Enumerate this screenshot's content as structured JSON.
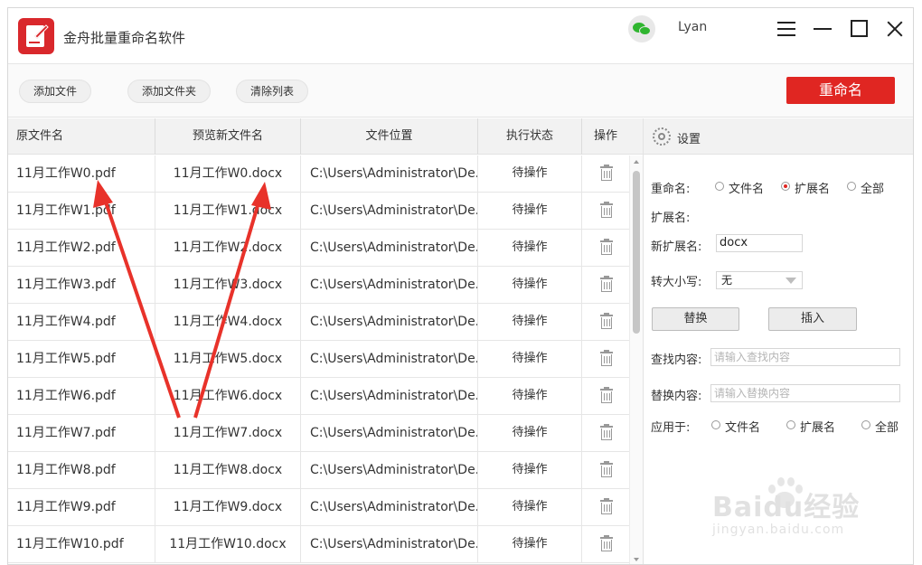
{
  "app": {
    "title": "金舟批量重命名软件",
    "user": "Lyan",
    "accent": "#e02622"
  },
  "toolbar": {
    "add_file": "添加文件",
    "add_folder": "添加文件夹",
    "clear_list": "清除列表",
    "rename": "重命名"
  },
  "table": {
    "headers": [
      "原文件名",
      "预览新文件名",
      "文件位置",
      "执行状态",
      "操作"
    ],
    "rows": [
      {
        "orig": "11月工作W0.pdf",
        "preview": "11月工作W0.docx",
        "path": "C:\\Users\\Administrator\\De...",
        "status": "待操作"
      },
      {
        "orig": "11月工作W1.pdf",
        "preview": "11月工作W1.docx",
        "path": "C:\\Users\\Administrator\\De...",
        "status": "待操作"
      },
      {
        "orig": "11月工作W2.pdf",
        "preview": "11月工作W2.docx",
        "path": "C:\\Users\\Administrator\\De...",
        "status": "待操作"
      },
      {
        "orig": "11月工作W3.pdf",
        "preview": "11月工作W3.docx",
        "path": "C:\\Users\\Administrator\\De...",
        "status": "待操作"
      },
      {
        "orig": "11月工作W4.pdf",
        "preview": "11月工作W4.docx",
        "path": "C:\\Users\\Administrator\\De...",
        "status": "待操作"
      },
      {
        "orig": "11月工作W5.pdf",
        "preview": "11月工作W5.docx",
        "path": "C:\\Users\\Administrator\\De...",
        "status": "待操作"
      },
      {
        "orig": "11月工作W6.pdf",
        "preview": "11月工作W6.docx",
        "path": "C:\\Users\\Administrator\\De...",
        "status": "待操作"
      },
      {
        "orig": "11月工作W7.pdf",
        "preview": "11月工作W7.docx",
        "path": "C:\\Users\\Administrator\\De...",
        "status": "待操作"
      },
      {
        "orig": "11月工作W8.pdf",
        "preview": "11月工作W8.docx",
        "path": "C:\\Users\\Administrator\\De...",
        "status": "待操作"
      },
      {
        "orig": "11月工作W9.pdf",
        "preview": "11月工作W9.docx",
        "path": "C:\\Users\\Administrator\\De...",
        "status": "待操作"
      },
      {
        "orig": "11月工作W10.pdf",
        "preview": "11月工作W10.docx",
        "path": "C:\\Users\\Administrator\\De...",
        "status": "待操作"
      }
    ]
  },
  "settings": {
    "title": "设置",
    "rename_label": "重命名:",
    "rename_options": [
      "文件名",
      "扩展名",
      "全部"
    ],
    "rename_selected": "扩展名",
    "ext_label": "扩展名:",
    "new_ext_label": "新扩展名:",
    "new_ext_value": "docx",
    "case_label": "转大小写:",
    "case_value": "无",
    "replace_btn": "替换",
    "insert_btn": "插入",
    "find_label": "查找内容:",
    "find_placeholder": "请输入查找内容",
    "replace_label": "替换内容:",
    "replace_placeholder": "请输入替换内容",
    "apply_label": "应用于:",
    "apply_options": [
      "文件名",
      "扩展名",
      "全部"
    ]
  },
  "annotation": {
    "arrow_color": "#e8322a"
  },
  "watermark": {
    "main": "Baidu经验",
    "sub": "jingyan.baidu.com"
  }
}
